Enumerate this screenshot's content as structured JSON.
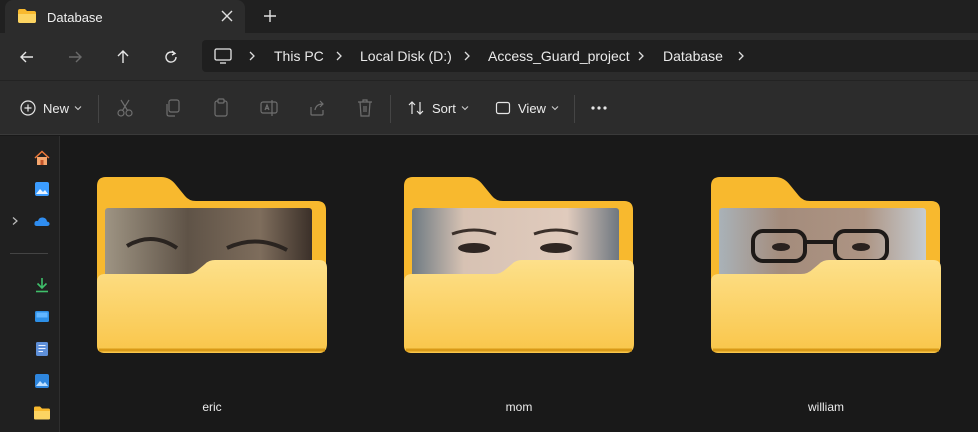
{
  "window": {
    "tab_title": "Database",
    "icons": {
      "tab": "folder-icon",
      "close": "close-icon",
      "new_tab": "plus-icon"
    }
  },
  "navigation": {
    "buttons": [
      "back-arrow-icon",
      "forward-arrow-icon",
      "up-arrow-icon",
      "refresh-icon"
    ],
    "breadcrumb": [
      "This PC",
      "Local Disk (D:)",
      "Access_Guard_project",
      "Database"
    ]
  },
  "toolbar": {
    "new_label": "New",
    "sort_label": "Sort",
    "view_label": "View",
    "actions": [
      "cut-icon",
      "copy-icon",
      "paste-icon",
      "rename-icon",
      "share-icon",
      "delete-icon",
      "more-icon"
    ]
  },
  "sidebar": {
    "items": [
      "home-icon",
      "gallery-icon",
      "onedrive-icon",
      "downloads-icon",
      "desktop-icon",
      "documents-icon",
      "pictures-icon",
      "folder-icon"
    ]
  },
  "folders": [
    {
      "name": "eric"
    },
    {
      "name": "mom"
    },
    {
      "name": "william"
    }
  ],
  "colors": {
    "folder_front": "#fcd462",
    "folder_back": "#f8b92e",
    "accent_blue": "#3b9cff",
    "accent_green": "#3fbf6a",
    "background": "#191919"
  }
}
